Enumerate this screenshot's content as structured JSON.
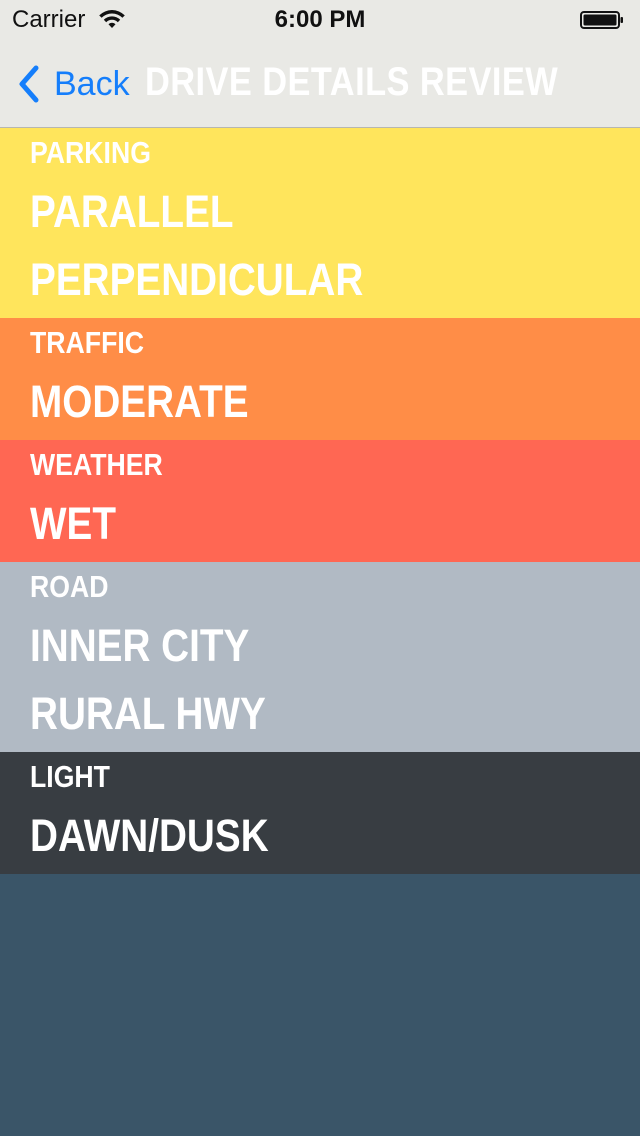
{
  "status_bar": {
    "carrier": "Carrier",
    "time": "6:00 PM",
    "wifi_icon": "wifi-icon",
    "battery_icon": "battery-icon"
  },
  "nav": {
    "back_label": "Back",
    "title": "DRIVE DETAILS REVIEW",
    "accent": "#157efb"
  },
  "sections": [
    {
      "key": "parking",
      "label": "PARKING",
      "values": [
        "PARALLEL",
        "PERPENDICULAR"
      ],
      "color": "#ffe55c"
    },
    {
      "key": "traffic",
      "label": "TRAFFIC",
      "values": [
        "MODERATE"
      ],
      "color": "#ff8d47"
    },
    {
      "key": "weather",
      "label": "WEATHER",
      "values": [
        "WET"
      ],
      "color": "#ff6753"
    },
    {
      "key": "road",
      "label": "ROAD",
      "values": [
        "INNER CITY",
        "RURAL HWY"
      ],
      "color": "#b1bac4"
    },
    {
      "key": "light",
      "label": "LIGHT",
      "values": [
        "DAWN/DUSK"
      ],
      "color": "#383d42"
    }
  ],
  "background_color": "#3a5568"
}
